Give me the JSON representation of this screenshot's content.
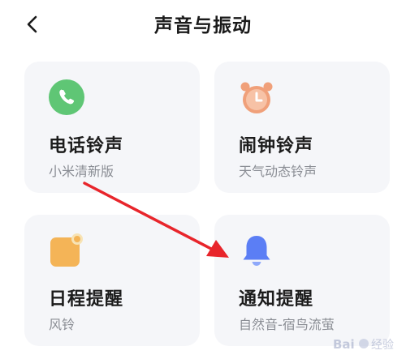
{
  "header": {
    "title": "声音与振动",
    "back_icon": "chevron-left-icon"
  },
  "cards": [
    {
      "id": "phone",
      "title": "电话铃声",
      "subtitle": "小米清新版",
      "icon": "phone-icon",
      "color": "#5fc675"
    },
    {
      "id": "alarm",
      "title": "闹钟铃声",
      "subtitle": "天气动态铃声",
      "icon": "alarm-clock-icon",
      "color": "#f0a07a"
    },
    {
      "id": "calendar",
      "title": "日程提醒",
      "subtitle": "风铃",
      "icon": "calendar-icon",
      "color": "#f4b457"
    },
    {
      "id": "notification",
      "title": "通知提醒",
      "subtitle": "自然音-宿鸟流萤",
      "icon": "bell-icon",
      "color": "#5b7ef5"
    }
  ],
  "annotation": {
    "arrow_color": "#e8252b"
  },
  "watermark": {
    "text": "Bai 经验"
  }
}
